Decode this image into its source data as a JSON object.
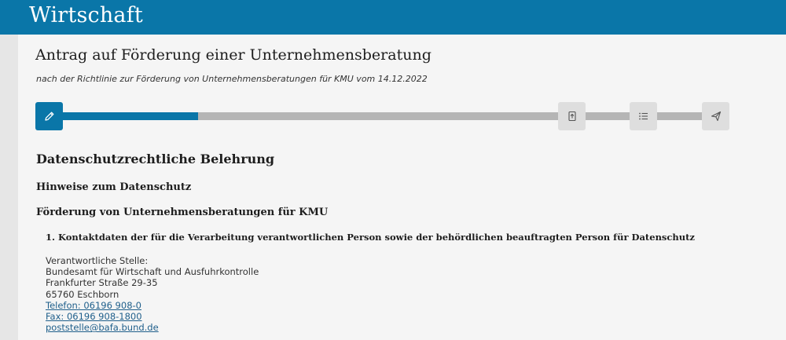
{
  "header": {
    "title": "Wirtschaft"
  },
  "page": {
    "title": "Antrag auf Förderung einer Unternehmensberatung",
    "subtitle": "nach der Richtlinie zur Förderung von Unternehmensberatungen für KMU vom 14.12.2022"
  },
  "stepper": {
    "progress_percent": 22,
    "steps": [
      {
        "icon": "pencil-icon",
        "active": true
      },
      {
        "icon": "upload-document-icon",
        "active": false
      },
      {
        "icon": "list-icon",
        "active": false
      },
      {
        "icon": "send-icon",
        "active": false
      }
    ]
  },
  "content": {
    "section_title": "Datenschutzrechtliche Belehrung",
    "subsection_title": "Hinweise zum Datenschutz",
    "topic_title": "Förderung von Unternehmensberatungen für KMU",
    "item_title": "1. Kontaktdaten der für die Verarbeitung verantwortlichen Person sowie der behördlichen beauftragten Person für Datenschutz",
    "contact": {
      "label": "Verantwortliche Stelle:",
      "org": "Bundesamt für Wirtschaft und Ausfuhrkontrolle",
      "street": "Frankfurter Straße 29-35",
      "city": "65760 Eschborn",
      "phone": "Telefon: 06196 908-0",
      "fax": "Fax: 06196 908-1800",
      "email": "poststelle@bafa.bund.de"
    }
  },
  "colors": {
    "brand": "#0a76a8",
    "track": "#b5b5b5",
    "link": "#1f5f8b"
  }
}
